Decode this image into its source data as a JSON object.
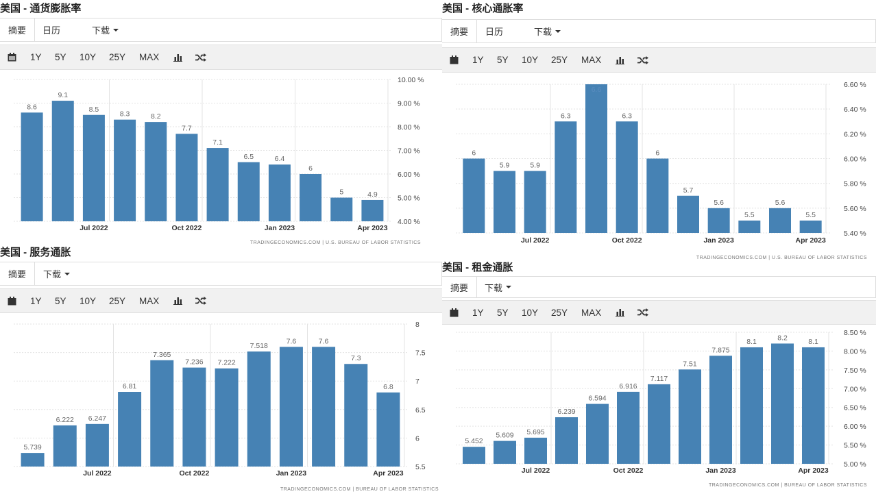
{
  "tabs_full": [
    "摘要",
    "日历",
    "下载"
  ],
  "tabs_short": [
    "摘要",
    "下载"
  ],
  "toolbar": {
    "calendar_icon": "calendar-icon",
    "ranges": [
      "1Y",
      "5Y",
      "10Y",
      "25Y",
      "MAX"
    ],
    "bar_icon": "bar-chart-icon",
    "shuffle_icon": "shuffle-icon"
  },
  "colors": {
    "bar": "#4682b4",
    "grid": "#e3e3e3",
    "label": "#666666"
  },
  "panels": [
    {
      "title": "美国 - 通货膨胀率",
      "tabs": [
        "摘要",
        "日历",
        "下载"
      ],
      "source": "TRADINGECONOMICS.COM  |  U.S. BUREAU OF LABOR STATISTICS"
    },
    {
      "title": "美国 - 核心通胀率",
      "tabs": [
        "摘要",
        "日历",
        "下载"
      ],
      "source": "TRADINGECONOMICS.COM  |  U.S. BUREAU OF LABOR STATISTICS"
    },
    {
      "title": "美国 - 服务通胀",
      "tabs": [
        "摘要",
        "下载"
      ],
      "source": "TRADINGECONOMICS.COM  |  BUREAU OF LABOR STATISTICS"
    },
    {
      "title": "美国 - 租金通胀",
      "tabs": [
        "摘要",
        "下载"
      ],
      "source": "TRADINGECONOMICS.COM  |  BUREAU OF LABOR STATISTICS"
    }
  ],
  "chart_data": [
    {
      "type": "bar",
      "title": "美国 - 通货膨胀率",
      "values": [
        8.6,
        9.1,
        8.5,
        8.3,
        8.2,
        7.7,
        7.1,
        6.5,
        6.4,
        6,
        5,
        4.9
      ],
      "labels": [
        "8.6",
        "9.1",
        "8.5",
        "8.3",
        "8.2",
        "7.7",
        "7.1",
        "6.5",
        "6.4",
        "6",
        "5",
        "4.9"
      ],
      "yticks": [
        "10.00 %",
        "9.00 %",
        "8.00 %",
        "7.00 %",
        "6.00 %",
        "5.00 %",
        "4.00 %"
      ],
      "ytick_values": [
        10,
        9,
        8,
        7,
        6,
        5,
        4
      ],
      "ylim": [
        4,
        10
      ],
      "xticks": [
        "Jul 2022",
        "Oct 2022",
        "Jan 2023",
        "Apr 2023"
      ],
      "xtick_index": [
        2,
        5,
        8,
        11
      ],
      "grid": true
    },
    {
      "type": "bar",
      "title": "美国 - 核心通胀率",
      "values": [
        6,
        5.9,
        5.9,
        6.3,
        6.6,
        6.3,
        6,
        5.7,
        5.6,
        5.5,
        5.6,
        5.5
      ],
      "labels": [
        "6",
        "5.9",
        "5.9",
        "6.3",
        "6.6",
        "6.3",
        "6",
        "5.7",
        "5.6",
        "5.5",
        "5.6",
        "5.5"
      ],
      "yticks": [
        "6.60 %",
        "6.40 %",
        "6.20 %",
        "6.00 %",
        "5.80 %",
        "5.60 %",
        "5.40 %"
      ],
      "ytick_values": [
        6.6,
        6.4,
        6.2,
        6.0,
        5.8,
        5.6,
        5.4
      ],
      "ylim": [
        5.4,
        6.6
      ],
      "xticks": [
        "Jul 2022",
        "Oct 2022",
        "Jan 2023",
        "Apr 2023"
      ],
      "xtick_index": [
        2,
        5,
        8,
        11
      ],
      "grid": true
    },
    {
      "type": "bar",
      "title": "美国 - 服务通胀",
      "values": [
        5.739,
        6.222,
        6.247,
        6.81,
        7.365,
        7.236,
        7.222,
        7.518,
        7.6,
        7.6,
        7.3,
        6.8
      ],
      "labels": [
        "5.739",
        "6.222",
        "6.247",
        "6.81",
        "7.365",
        "7.236",
        "7.222",
        "7.518",
        "7.6",
        "7.6",
        "7.3",
        "6.8"
      ],
      "yticks": [
        "8",
        "7.5",
        "7",
        "6.5",
        "6",
        "5.5"
      ],
      "ytick_values": [
        8,
        7.5,
        7,
        6.5,
        6,
        5.5
      ],
      "ylim": [
        5.5,
        8
      ],
      "xticks": [
        "Jul 2022",
        "Oct 2022",
        "Jan 2023",
        "Apr 2023"
      ],
      "xtick_index": [
        2,
        5,
        8,
        11
      ],
      "grid": true
    },
    {
      "type": "bar",
      "title": "美国 - 租金通胀",
      "values": [
        5.452,
        5.609,
        5.695,
        6.239,
        6.594,
        6.916,
        7.117,
        7.51,
        7.875,
        8.1,
        8.2,
        8.1
      ],
      "labels": [
        "5.452",
        "5.609",
        "5.695",
        "6.239",
        "6.594",
        "6.916",
        "7.117",
        "7.51",
        "7.875",
        "8.1",
        "8.2",
        "8.1"
      ],
      "yticks": [
        "8.50 %",
        "8.00 %",
        "7.50 %",
        "7.00 %",
        "6.50 %",
        "6.00 %",
        "5.50 %",
        "5.00 %"
      ],
      "ytick_values": [
        8.5,
        8.0,
        7.5,
        7.0,
        6.5,
        6.0,
        5.5,
        5.0
      ],
      "ylim": [
        5,
        8.5
      ],
      "xticks": [
        "Jul 2022",
        "Oct 2022",
        "Jan 2023",
        "Apr 2023"
      ],
      "xtick_index": [
        2,
        5,
        8,
        11
      ],
      "grid": true
    }
  ]
}
